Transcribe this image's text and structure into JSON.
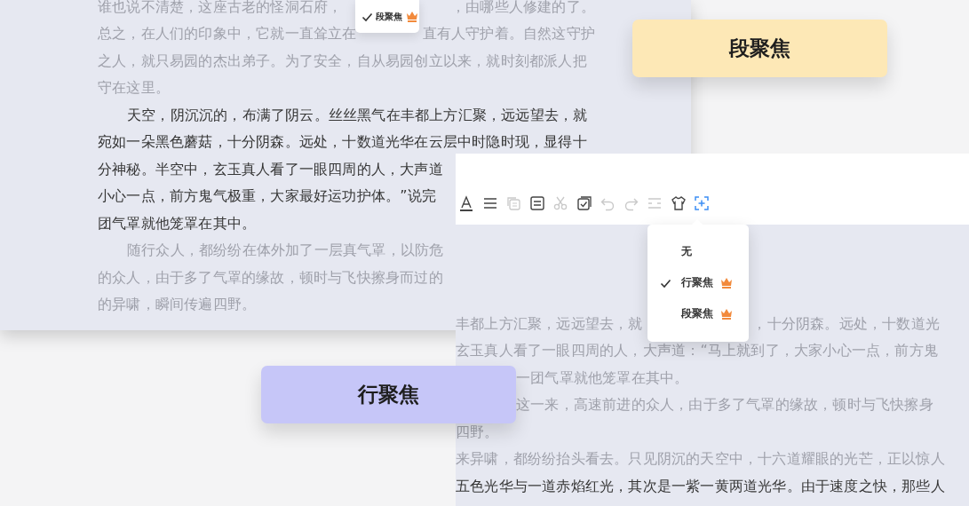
{
  "back_editor": {
    "menu": [
      {
        "label": "段聚焦",
        "selected": true,
        "premium": true
      }
    ],
    "lines": [
      {
        "parts": [
          "谁也说不清楚，这座古老的怪洞石府，",
          "，由哪些人修建的了。"
        ],
        "dim": true,
        "indent": false,
        "mid_start": false
      },
      {
        "parts": [
          "总之，在人们的印象中，它就一直耸立在",
          "直有人守护着。自然这守护"
        ],
        "dim": true,
        "indent": false,
        "mid_start": false
      },
      {
        "parts": [
          "之人，就只易园的杰出弟子。为了安全，自从易园创立以来，就时刻都派人把"
        ],
        "dim": true,
        "indent": false,
        "mid_start": false
      },
      {
        "parts": [
          "守在这里。"
        ],
        "dim": true,
        "indent": false,
        "mid_start": false
      },
      {
        "parts": [
          "天空，阴沉沉的，布满了阴云。丝丝黑气在丰都上方汇聚，远远望去，就"
        ],
        "dim": false,
        "indent": true,
        "mid_start": false
      },
      {
        "parts": [
          "宛如一朵黑色蘑菇，十分阴森。远处，十数道光华在云层中时隐时现，显得十"
        ],
        "dim": false,
        "indent": false,
        "mid_start": false
      },
      {
        "parts": [
          "分神秘。半空中，玄玉真人看了一眼四周的人，大声道"
        ],
        "dim": false,
        "indent": false,
        "mid_start": false
      },
      {
        "parts": [
          "小心一点，前方鬼气极重，大家最好运功护体。”说完"
        ],
        "dim": false,
        "indent": false,
        "mid_start": false
      },
      {
        "parts": [
          "团气罩就他笼罩在其中。"
        ],
        "dim": false,
        "indent": false,
        "mid_start": false
      },
      {
        "parts": [
          "随行众人，都纷纷在体外加了一层真气罩，以防危"
        ],
        "dim": true,
        "indent": true,
        "mid_start": false
      },
      {
        "parts": [
          "的众人，由于多了气罩的缘故，顿时与飞快擦身而过的"
        ],
        "dim": true,
        "indent": false,
        "mid_start": false
      },
      {
        "parts": [
          "的异啸，瞬间传遍四野。"
        ],
        "dim": true,
        "indent": false,
        "mid_start": false
      }
    ]
  },
  "paragraph_focus_label": "段聚焦",
  "front_editor": {
    "toolbar": [
      {
        "kind": "text-color",
        "disabled": false,
        "active": false
      },
      {
        "kind": "align",
        "disabled": false,
        "active": false
      },
      {
        "kind": "copy",
        "disabled": true,
        "active": false
      },
      {
        "kind": "note",
        "disabled": false,
        "active": false
      },
      {
        "kind": "cut",
        "disabled": true,
        "active": false
      },
      {
        "kind": "select",
        "disabled": false,
        "active": false
      },
      {
        "kind": "undo",
        "disabled": true,
        "active": false
      },
      {
        "kind": "redo",
        "disabled": true,
        "active": false
      },
      {
        "kind": "spacing",
        "disabled": true,
        "active": false
      },
      {
        "kind": "theme",
        "disabled": false,
        "active": false
      },
      {
        "kind": "focus",
        "disabled": false,
        "active": true
      }
    ],
    "focus_menu": [
      {
        "label": "无",
        "selected": false,
        "premium": false
      },
      {
        "label": "行聚焦",
        "selected": true,
        "premium": true
      },
      {
        "label": "段聚焦",
        "selected": false,
        "premium": true
      }
    ],
    "lines": [
      {
        "parts": [
          "丰都上方汇聚，远远望去，就",
          "，十分阴森。远处，十数道光"
        ],
        "dim": true,
        "indent": false,
        "mid_start": false
      },
      {
        "parts": [
          "玄玉真人看了一眼四周的人，大声道：“马上就到了，大家小心一点，前方鬼"
        ],
        "dim": true,
        "indent": false,
        "mid_start": false
      },
      {
        "parts": [
          "一团气罩就他笼罩在其中。"
        ],
        "dim": true,
        "indent": false,
        "mid_start": true
      },
      {
        "parts": [
          "这一来，高速前进的众人，由于多了气罩的缘故，顿时与飞快擦身"
        ],
        "dim": true,
        "indent": false,
        "mid_start": true
      },
      {
        "parts": [
          "四野。"
        ],
        "dim": true,
        "indent": false,
        "mid_start": false
      },
      {
        "parts": [
          "来异啸，都纷纷抬头看去。只见阴沉的天空中，十六道耀眼的光芒，正以惊人"
        ],
        "dim": true,
        "indent": false,
        "mid_start": false
      },
      {
        "parts": [
          "五色光华与一道赤焰红光，其次是一紫一黄两道光华。由于速度之快，那些人"
        ],
        "dim": false,
        "indent": false,
        "mid_start": false
      }
    ]
  },
  "line_focus_label": "行聚焦"
}
